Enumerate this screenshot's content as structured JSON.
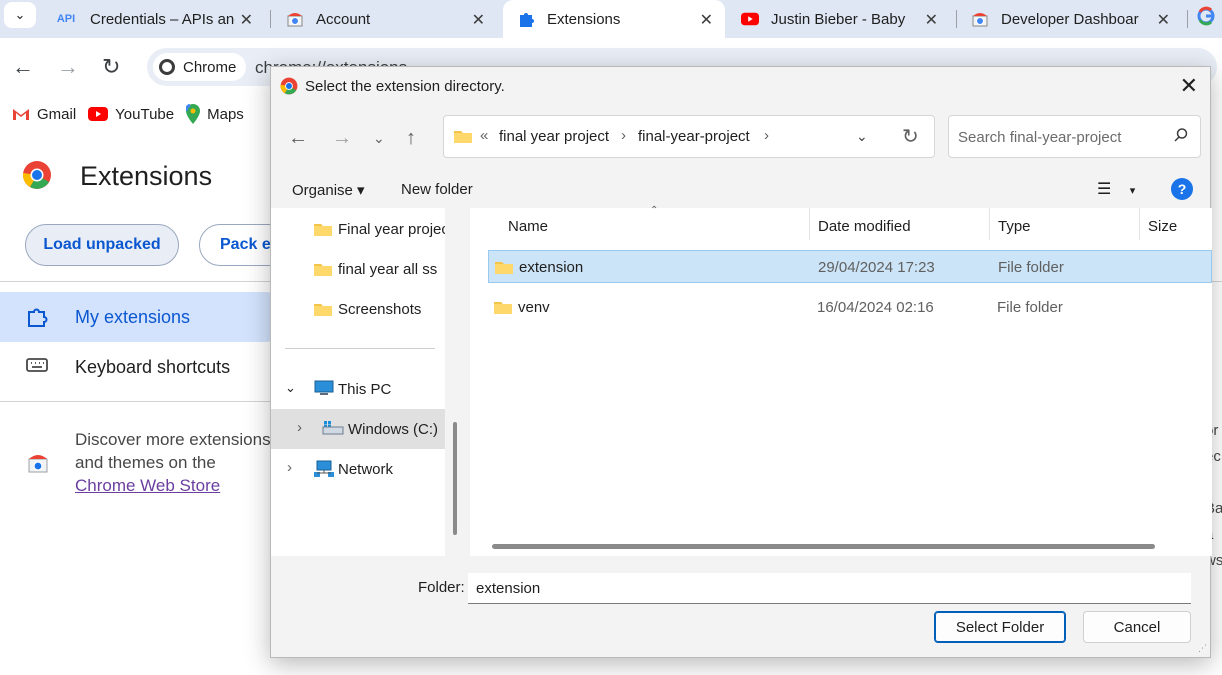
{
  "tabs": [
    {
      "title": "Credentials – APIs and",
      "icon": "api-icon",
      "active": false
    },
    {
      "title": "Account",
      "icon": "chrome-webstore-icon",
      "active": false
    },
    {
      "title": "Extensions",
      "icon": "puzzle-icon",
      "active": true
    },
    {
      "title": "Justin Bieber - Baby",
      "icon": "youtube-icon",
      "active": false
    },
    {
      "title": "Developer Dashboard",
      "icon": "chrome-webstore-icon",
      "active": false
    }
  ],
  "api_badge": "API",
  "omnibox": {
    "chip_label": "Chrome",
    "url": "chrome://extensions"
  },
  "bookmarks": [
    {
      "label": "Gmail",
      "icon": "gmail-icon"
    },
    {
      "label": "YouTube",
      "icon": "youtube-icon"
    },
    {
      "label": "Maps",
      "icon": "maps-icon"
    }
  ],
  "extensions_page": {
    "title": "Extensions",
    "load_unpacked": "Load unpacked",
    "pack_extension": "Pack ex",
    "sidebar": [
      {
        "label": "My extensions",
        "icon": "extension-icon",
        "selected": true
      },
      {
        "label": "Keyboard shortcuts",
        "icon": "keyboard-icon",
        "selected": false
      }
    ],
    "discover_prefix": "Discover more extensions and themes on the ",
    "discover_link": "Chrome Web Store",
    "right_peek": [
      "or",
      "ec",
      "r",
      "Ba",
      "a",
      "ws"
    ]
  },
  "dialog": {
    "title": "Select the extension directory.",
    "breadcrumb_overflow": "«",
    "breadcrumb": [
      "final year project",
      "final-year-project"
    ],
    "search_placeholder": "Search final-year-project",
    "organise": "Organise ▾",
    "new_folder": "New folder",
    "help": "?",
    "nav_items": [
      {
        "label": "Final year project",
        "icon": "folder-icon"
      },
      {
        "label": "final year all ss",
        "icon": "folder-icon"
      },
      {
        "label": "Screenshots",
        "icon": "folder-icon"
      },
      {
        "label": "This PC",
        "icon": "computer-icon",
        "expanded": true
      },
      {
        "label": "Windows (C:)",
        "icon": "drive-icon",
        "selected": true
      },
      {
        "label": "Network",
        "icon": "network-icon"
      }
    ],
    "columns": [
      "Name",
      "Date modified",
      "Type",
      "Size"
    ],
    "files": [
      {
        "name": "extension",
        "date": "29/04/2024 17:23",
        "type": "File folder",
        "selected": true
      },
      {
        "name": "venv",
        "date": "16/04/2024 02:16",
        "type": "File folder",
        "selected": false
      }
    ],
    "folder_label": "Folder:",
    "folder_value": "extension",
    "select_button": "Select Folder",
    "cancel_button": "Cancel"
  },
  "colors": {
    "accent": "#0b57d0",
    "selection": "#cce4f7",
    "tab_strip": "#dfe7f4"
  }
}
